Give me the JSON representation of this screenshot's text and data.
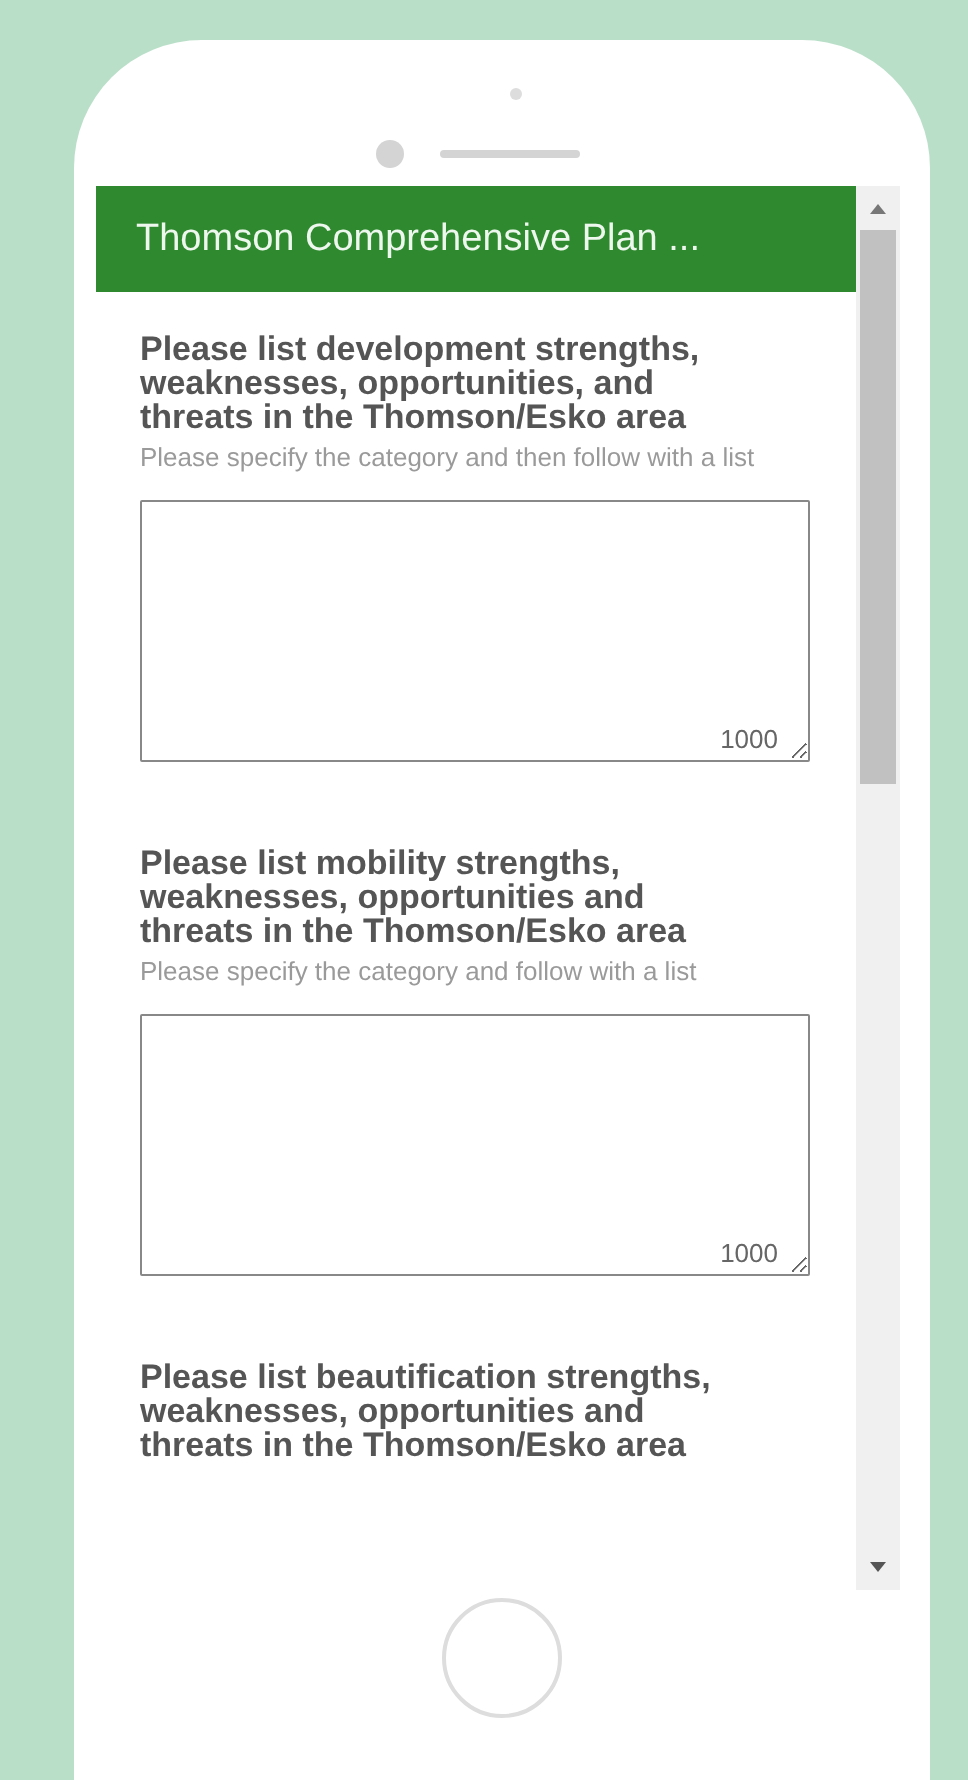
{
  "header": {
    "title": "Thomson Comprehensive Plan ..."
  },
  "questions": [
    {
      "title": "Please list development strengths, weaknesses, opportunities, and threats in the Thomson/Esko area",
      "hint": "Please specify the category and then follow with a list",
      "counter": "1000"
    },
    {
      "title": "Please list mobility strengths, weaknesses, opportunities and threats in the Thomson/Esko area",
      "hint": "Please specify the category and follow with a list",
      "counter": "1000"
    },
    {
      "title": "Please list beautification strengths, weaknesses, opportunities and threats in the Thomson/Esko area"
    }
  ]
}
